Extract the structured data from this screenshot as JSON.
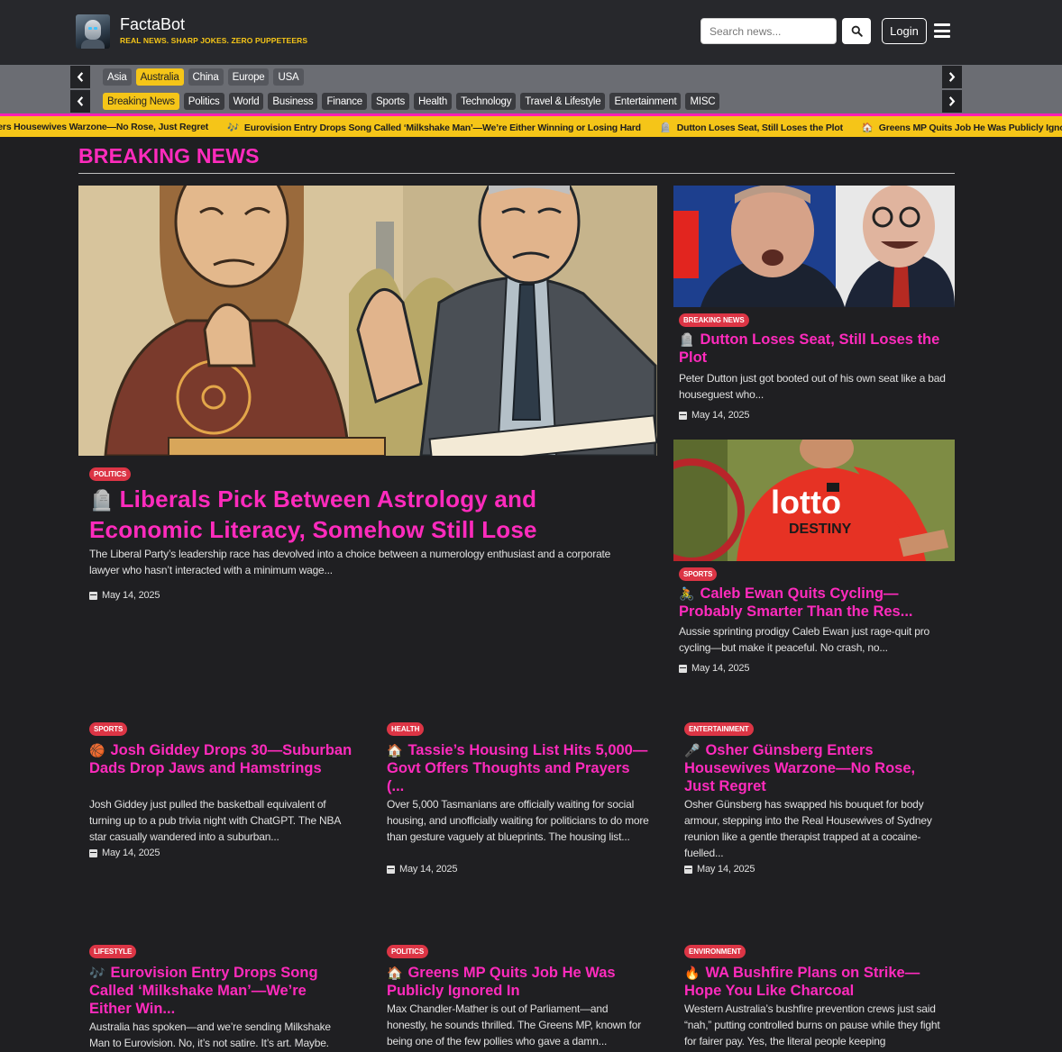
{
  "header": {
    "site_title": "FactaBot",
    "tagline": "REAL NEWS. SHARP JOKES. ZERO PUPPETEERS",
    "search_placeholder": "Search news...",
    "login_label": "Login"
  },
  "regions": {
    "items": [
      "Asia",
      "Australia",
      "China",
      "Europe",
      "USA"
    ],
    "active": "Australia"
  },
  "categories": {
    "items": [
      "Breaking News",
      "Politics",
      "World",
      "Business",
      "Finance",
      "Sports",
      "Health",
      "Technology",
      "Travel & Lifestyle",
      "Entertainment",
      "MISC"
    ],
    "active": "Breaking News"
  },
  "ticker": [
    {
      "icon": "",
      "text": "ters Housewives Warzone—No Rose, Just Regret"
    },
    {
      "icon": "🎶",
      "text": "Eurovision Entry Drops Song Called ‘Milkshake Man’—We’re Either Winning or Losing Hard"
    },
    {
      "icon": "🪦",
      "text": "Dutton Loses Seat, Still Loses the Plot"
    },
    {
      "icon": "🏠",
      "text": "Greens MP Quits Job He Was Publicly Ignored In"
    }
  ],
  "section_title": "BREAKING NEWS",
  "featured": {
    "badge": "POLITICS",
    "icon": "🪦",
    "title": "Liberals Pick Between Astrology and Economic Literacy, Somehow Still Lose",
    "excerpt": "The Liberal Party’s leadership race has devolved into a choice between a numerology enthusiast and a corporate lawyer who hasn’t interacted with a minimum wage...",
    "date": "May 14, 2025"
  },
  "side": [
    {
      "badge": "BREAKING NEWS",
      "icon": "🪦",
      "title": "Dutton Loses Seat, Still Loses the Plot",
      "excerpt": "Peter Dutton just got booted out of his own seat like a bad houseguest who...",
      "date": "May 14, 2025"
    },
    {
      "badge": "SPORTS",
      "icon": "🚴",
      "title": "Caleb Ewan Quits Cycling—Probably Smarter Than the Res...",
      "excerpt": "Aussie sprinting prodigy Caleb Ewan just rage-quit pro cycling—but make it peaceful. No crash, no...",
      "date": "May 14, 2025"
    }
  ],
  "grid": [
    {
      "badge": "SPORTS",
      "icon": "🏀",
      "title": "Josh Giddey Drops 30—Suburban Dads Drop Jaws and Hamstrings",
      "excerpt": "Josh Giddey just pulled the basketball equivalent of turning up to a pub trivia night with ChatGPT. The NBA star casually wandered into a suburban...",
      "date": "May 14, 2025"
    },
    {
      "badge": "HEALTH",
      "icon": "🏠",
      "title": "Tassie’s Housing List Hits 5,000—Govt Offers Thoughts and Prayers (...",
      "excerpt": "Over 5,000 Tasmanians are officially waiting for social housing, and unofficially waiting for politicians to do more than gesture vaguely at blueprints. The housing list...",
      "date": "May 14, 2025"
    },
    {
      "badge": "ENTERTAINMENT",
      "icon": "🎤",
      "title": "Osher Günsberg Enters Housewives Warzone—No Rose, Just Regret",
      "excerpt": "Osher Günsberg has swapped his bouquet for body armour, stepping into the Real Housewives of Sydney reunion like a gentle therapist trapped at a cocaine-fuelled...",
      "date": "May 14, 2025"
    },
    {
      "badge": "LIFESTYLE",
      "icon": "🎶",
      "title": "Eurovision Entry Drops Song Called ‘Milkshake Man’—We’re Either Win...",
      "excerpt": "Australia has spoken—and we’re sending Milkshake Man to Eurovision. No, it’s not satire. It’s art. Maybe.",
      "date": ""
    },
    {
      "badge": "POLITICS",
      "icon": "🏠",
      "title": "Greens MP Quits Job He Was Publicly Ignored In",
      "excerpt": "Max Chandler-Mather is out of Parliament—and honestly, he sounds thrilled. The Greens MP, known for being one of the few pollies who gave a damn...",
      "date": ""
    },
    {
      "badge": "ENVIRONMENT",
      "icon": "🔥",
      "title": "WA Bushfire Plans on Strike—Hope You Like Charcoal",
      "excerpt": "Western Australia’s bushfire prevention crews just said “nah,” putting controlled burns on pause while they fight for fairer pay. Yes, the literal people keeping",
      "date": ""
    }
  ]
}
